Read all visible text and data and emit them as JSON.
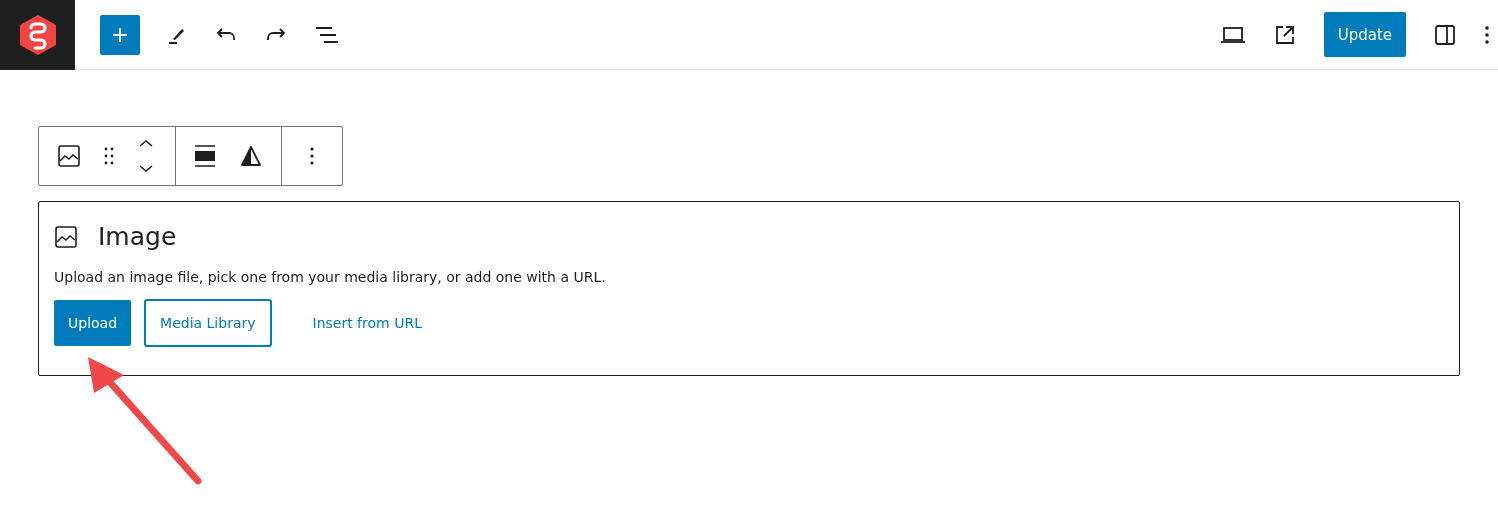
{
  "header": {
    "update_button": "Update"
  },
  "block": {
    "title": "Image",
    "description": "Upload an image file, pick one from your media library, or add one with a URL.",
    "buttons": [
      {
        "label": "Upload",
        "kind": "primary"
      },
      {
        "label": "Media Library",
        "kind": "secondary"
      },
      {
        "label": "Insert from URL",
        "kind": "link"
      }
    ]
  }
}
